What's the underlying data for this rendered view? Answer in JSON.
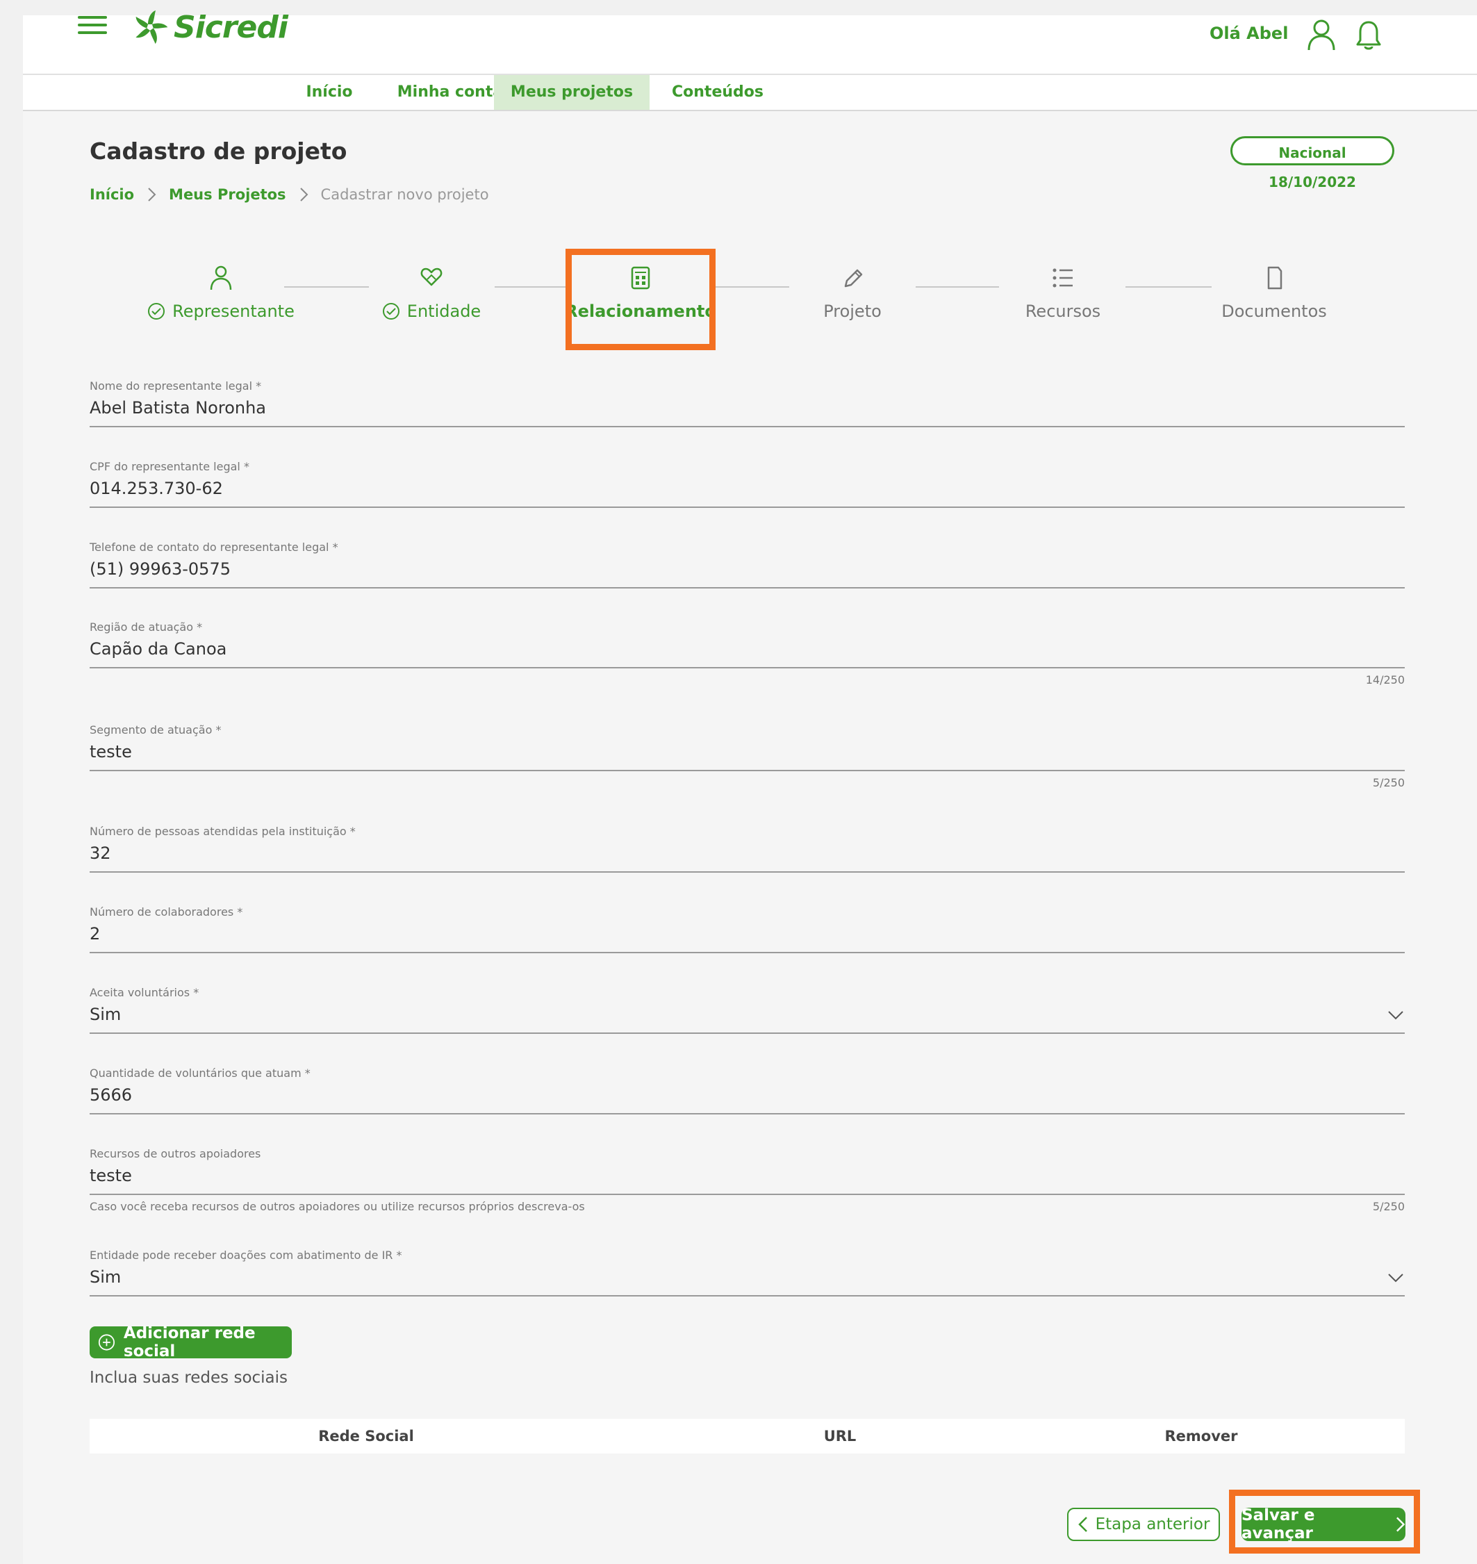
{
  "header": {
    "logo_text": "Sicredi",
    "greeting": "Olá Abel"
  },
  "nav": {
    "tabs": [
      {
        "label": "Início"
      },
      {
        "label": "Minha conta"
      },
      {
        "label": "Meus projetos",
        "active": true
      },
      {
        "label": "Conteúdos"
      }
    ]
  },
  "page": {
    "title": "Cadastro de projeto",
    "badge": "Nacional 18/10/2022"
  },
  "breadcrumb": {
    "items": [
      "Início",
      "Meus Projetos",
      "Cadastrar novo projeto"
    ]
  },
  "stepper": {
    "steps": [
      {
        "label": "Representante",
        "state": "done",
        "icon": "person-icon"
      },
      {
        "label": "Entidade",
        "state": "done",
        "icon": "heart-hand-icon"
      },
      {
        "label": "Relacionamento",
        "state": "current",
        "icon": "calculator-icon"
      },
      {
        "label": "Projeto",
        "state": "pending",
        "icon": "pencil-icon"
      },
      {
        "label": "Recursos",
        "state": "pending",
        "icon": "list-icon"
      },
      {
        "label": "Documentos",
        "state": "pending",
        "icon": "document-icon"
      }
    ]
  },
  "form": {
    "nome": {
      "label": "Nome do representante legal *",
      "value": "Abel Batista Noronha"
    },
    "cpf": {
      "label": "CPF do representante legal *",
      "value": "014.253.730-62"
    },
    "telefone": {
      "label": "Telefone de contato do representante legal *",
      "value": "(51) 99963-0575"
    },
    "regiao": {
      "label": "Região de atuação *",
      "value": "Capão da Canoa",
      "counter": "14/250"
    },
    "segmento": {
      "label": "Segmento de atuação *",
      "value": "teste",
      "counter": "5/250"
    },
    "pessoas": {
      "label": "Número de pessoas atendidas pela instituição *",
      "value": "32"
    },
    "colaboradores": {
      "label": "Número de colaboradores *",
      "value": "2"
    },
    "voluntarios": {
      "label": "Aceita voluntários *",
      "value": "Sim"
    },
    "qtd_voluntarios": {
      "label": "Quantidade de voluntários que atuam *",
      "value": "5666"
    },
    "recursos": {
      "label": "Recursos de outros apoiadores",
      "value": "teste",
      "hint": "Caso você receba recursos de outros apoiadores ou utilize recursos próprios descreva-os",
      "counter": "5/250"
    },
    "doacoes_ir": {
      "label": "Entidade pode receber doações com abatimento de IR *",
      "value": "Sim"
    }
  },
  "social": {
    "add_button": "Adicionar rede social",
    "hint": "Inclua suas redes sociais",
    "columns": [
      "Rede Social",
      "URL",
      "Remover"
    ]
  },
  "actions": {
    "prev": "Etapa anterior",
    "next": "Salvar e avançar"
  },
  "colors": {
    "brand_green": "#3d9a2d",
    "highlight_orange": "#f37021",
    "active_tab_bg": "#d9ecd2"
  }
}
